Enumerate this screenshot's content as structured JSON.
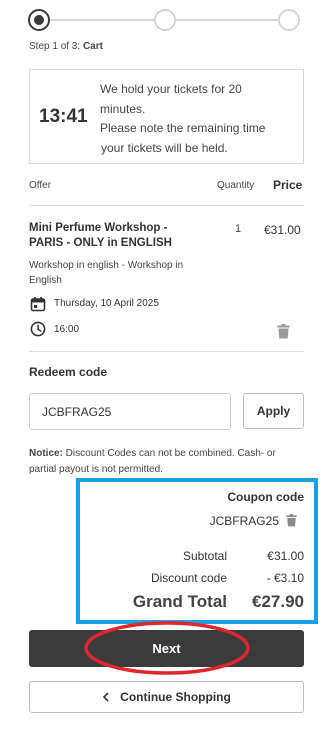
{
  "stepper": {
    "label_prefix": "Step 1 of 3:",
    "label_step": "Cart"
  },
  "timer": {
    "time": "13:41",
    "line1": "We hold your tickets for 20",
    "line2": "minutes.",
    "line3": "Please note the remaining time",
    "line4": "your tickets will be held."
  },
  "table": {
    "col_offer": "Offer",
    "col_quantity": "Quantity",
    "col_price": "Price"
  },
  "item": {
    "title_line1": "Mini Perfume Workshop -",
    "title_line2": "PARIS - ONLY in ENGLISH",
    "quantity": "1",
    "price": "€31.00",
    "desc_line1": "Workshop in english - Workshop in",
    "desc_line2": "English",
    "date": "Thursday, 10 April 2025",
    "time": "16:00"
  },
  "redeem": {
    "label": "Redeem code",
    "input_value": "JCBFRAG25",
    "apply_label": "Apply"
  },
  "notice": {
    "label": "Notice:",
    "text_line1": " Discount Codes can not be combined. Cash- or",
    "text_line2": "partial payout is not permitted."
  },
  "summary": {
    "coupon_label": "Coupon code",
    "coupon_value": "JCBFRAG25",
    "subtotal_label": "Subtotal",
    "subtotal_value": "€31.00",
    "discount_label": "Discount code",
    "discount_value": "- €3.10",
    "grand_label": "Grand Total",
    "grand_value": "€27.90"
  },
  "actions": {
    "next_label": "Next",
    "continue_label": "Continue Shopping"
  },
  "colors": {
    "highlight_box": "#1a9fe0",
    "highlight_ellipse": "#e0262d",
    "button_dark": "#3b3b3b"
  },
  "icons": {
    "calendar": "calendar-icon",
    "clock": "clock-icon",
    "trash": "trash-icon",
    "chevron": "chevron-left-icon"
  }
}
